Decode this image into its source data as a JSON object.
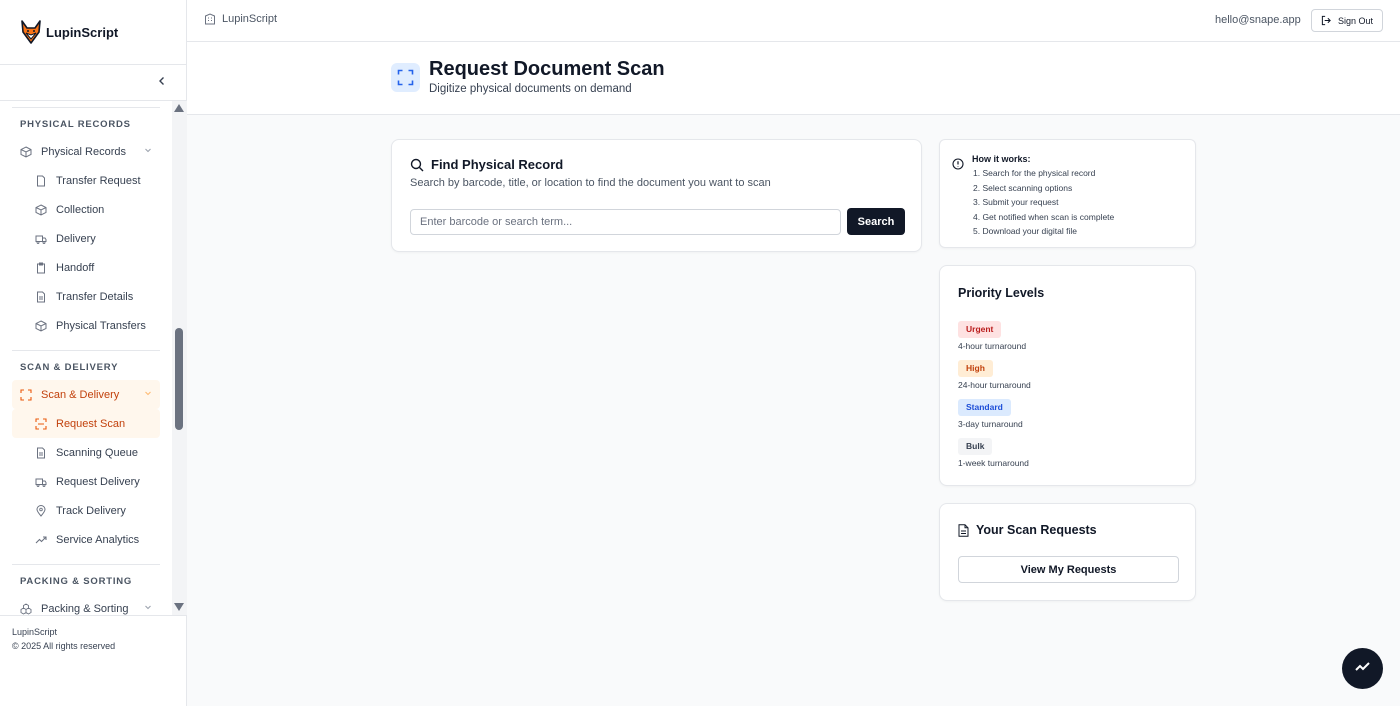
{
  "app": {
    "name": "LupinScript",
    "footer_brand": "LupinScript",
    "footer_copy": "© 2025 All rights reserved"
  },
  "colors": {
    "accent": "#ea580c",
    "active_bg": "#fff7ed",
    "primary_dark": "#111827",
    "header_icon_bg": "#e0edff"
  },
  "topbar": {
    "breadcrumb": "LupinScript",
    "email": "hello@snape.app",
    "sign_out": "Sign Out"
  },
  "sidebar": {
    "sections": [
      {
        "label": "PHYSICAL RECORDS",
        "parent": {
          "label": "Physical Records",
          "icon": "package-icon"
        },
        "items": [
          {
            "label": "Transfer Request",
            "icon": "file-icon"
          },
          {
            "label": "Collection",
            "icon": "package-icon"
          },
          {
            "label": "Delivery",
            "icon": "truck-icon"
          },
          {
            "label": "Handoff",
            "icon": "clipboard-icon"
          },
          {
            "label": "Transfer Details",
            "icon": "file-text-icon"
          },
          {
            "label": "Physical Transfers",
            "icon": "package-icon"
          }
        ]
      },
      {
        "label": "SCAN & DELIVERY",
        "parent": {
          "label": "Scan & Delivery",
          "icon": "scan-icon"
        },
        "items": [
          {
            "label": "Request Scan",
            "icon": "scan-line-icon",
            "active": true
          },
          {
            "label": "Scanning Queue",
            "icon": "file-text-icon"
          },
          {
            "label": "Request Delivery",
            "icon": "truck-icon"
          },
          {
            "label": "Track Delivery",
            "icon": "map-pin-icon"
          },
          {
            "label": "Service Analytics",
            "icon": "trending-up-icon"
          }
        ]
      },
      {
        "label": "PACKING & SORTING",
        "parent": {
          "label": "Packing & Sorting",
          "icon": "boxes-icon"
        }
      }
    ]
  },
  "header": {
    "title": "Request Document Scan",
    "subtitle": "Digitize physical documents on demand"
  },
  "find": {
    "title": "Find Physical Record",
    "subtitle": "Search by barcode, title, or location to find the document you want to scan",
    "placeholder": "Enter barcode or search term...",
    "value": "",
    "button": "Search"
  },
  "how": {
    "title": "How it works:",
    "steps": [
      "1.  Search for the physical record",
      "2.  Select scanning options",
      "3.  Submit your request",
      "4.  Get notified when scan is complete",
      "5.  Download your digital file"
    ]
  },
  "priority": {
    "title": "Priority Levels",
    "levels": [
      {
        "label": "Urgent",
        "desc": "4-hour turnaround",
        "bg": "#fee2e2",
        "fg": "#b91c1c"
      },
      {
        "label": "High",
        "desc": "24-hour turnaround",
        "bg": "#ffedd5",
        "fg": "#c2410c"
      },
      {
        "label": "Standard",
        "desc": "3-day turnaround",
        "bg": "#dbeafe",
        "fg": "#1d4ed8"
      },
      {
        "label": "Bulk",
        "desc": "1-week turnaround",
        "bg": "#f3f4f6",
        "fg": "#374151"
      }
    ]
  },
  "requests": {
    "title": "Your Scan Requests",
    "button": "View My Requests"
  }
}
